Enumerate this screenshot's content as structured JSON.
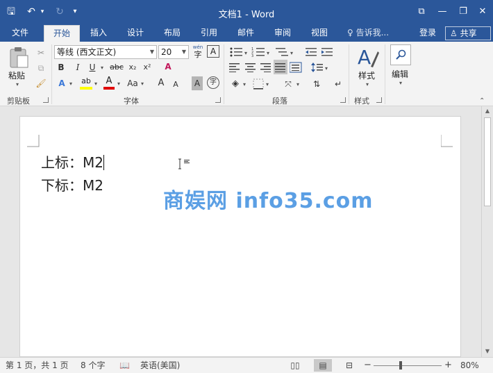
{
  "window": {
    "title": "文档1 - Word",
    "qa_save": "🖫",
    "qa_undo": "↶",
    "qa_redo": "↻",
    "qa_customize": "▾",
    "btn_ribbon_options": "⧉",
    "btn_minimize": "—",
    "btn_restore": "❐",
    "btn_close": "✕"
  },
  "tabs": [
    {
      "label": "文件"
    },
    {
      "label": "开始"
    },
    {
      "label": "插入"
    },
    {
      "label": "设计"
    },
    {
      "label": "布局"
    },
    {
      "label": "引用"
    },
    {
      "label": "邮件"
    },
    {
      "label": "审阅"
    },
    {
      "label": "视图"
    }
  ],
  "active_tab": "开始",
  "tell_me": "♀ 告诉我...",
  "login": "登录",
  "share": "♙ 共享",
  "ribbon": {
    "clipboard": {
      "label": "剪贴板",
      "paste": "粘贴"
    },
    "font": {
      "label": "字体",
      "font_name": "等线 (西文正文)",
      "font_size": "20",
      "wen_label": "wén",
      "wen_char": "字",
      "bold": "B",
      "italic": "I",
      "underline": "U",
      "strike": "abc",
      "subscript": "x₂",
      "superscript": "x²",
      "clear": "A",
      "effects": "A",
      "highlight": "ab",
      "font_color": "A",
      "change_case": "Aa",
      "grow": "A",
      "shrink": "A",
      "shading": "A",
      "enclose": "字",
      "highlight_color": "#ffff00",
      "font_color_bar": "#e00000"
    },
    "paragraph": {
      "label": "段落"
    },
    "styles": {
      "label": "样式",
      "styles_btn": "样式"
    },
    "editing": {
      "edit_btn": "编辑"
    }
  },
  "document": {
    "line1": "上标：M2",
    "line2": "下标：M2",
    "watermark": "商娱网 info35.com"
  },
  "status": {
    "page": "第 1 页，共 1 页",
    "words": "8 个字",
    "language": "英语(美国)",
    "zoom": "80%",
    "zoom_minus": "−",
    "zoom_plus": "+"
  }
}
